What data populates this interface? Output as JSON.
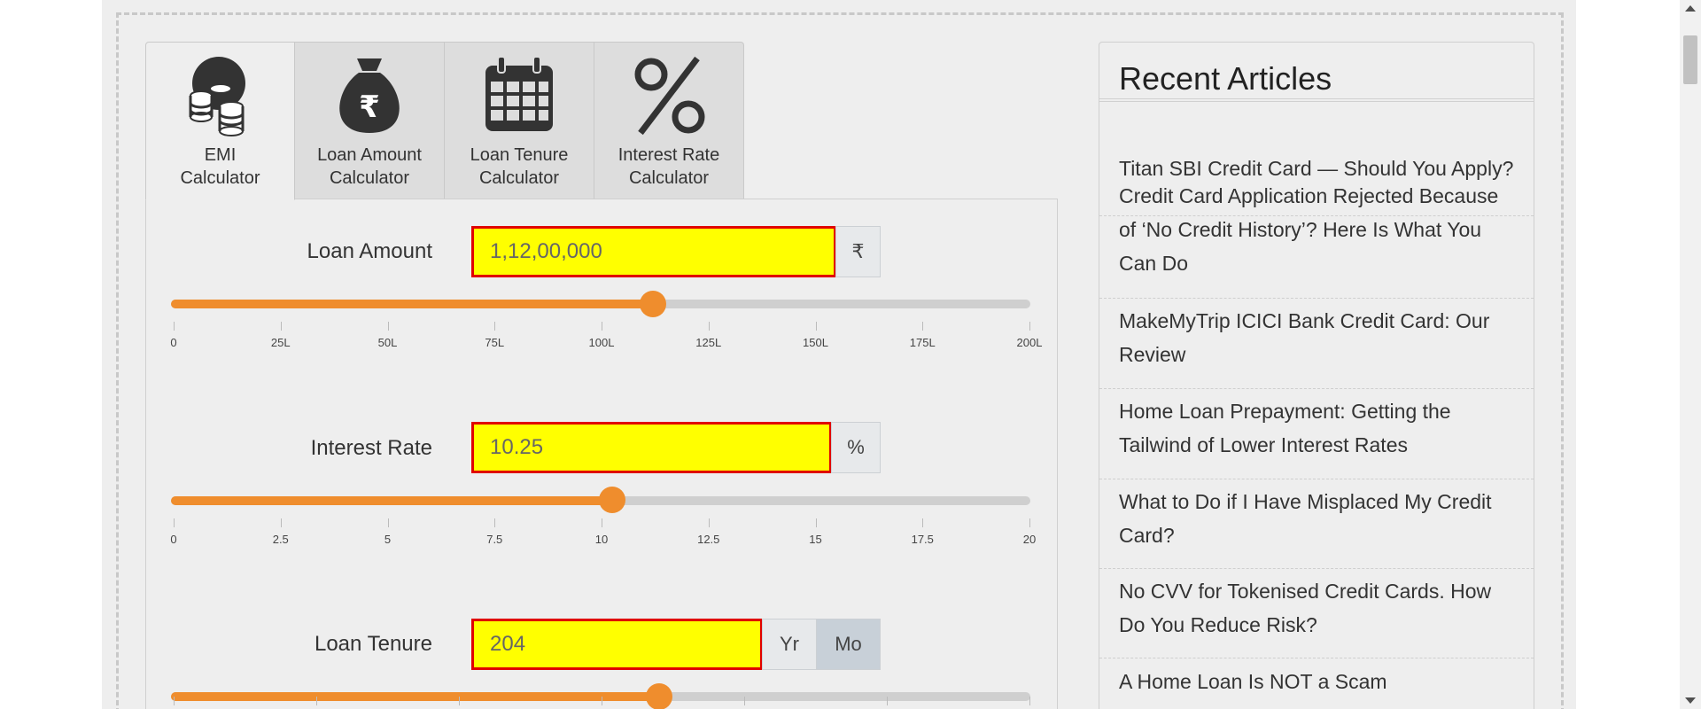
{
  "tabs": [
    {
      "line1": "EMI",
      "line2": "Calculator",
      "icon": "coins-icon",
      "active": true
    },
    {
      "line1": "Loan Amount",
      "line2": "Calculator",
      "icon": "money-bag-icon",
      "active": false
    },
    {
      "line1": "Loan Tenure",
      "line2": "Calculator",
      "icon": "calendar-icon",
      "active": false
    },
    {
      "line1": "Interest Rate",
      "line2": "Calculator",
      "icon": "percent-icon",
      "active": false
    }
  ],
  "loan_amount": {
    "label": "Loan Amount",
    "value": "1,12,00,000",
    "unit": "₹",
    "slider_fraction": 0.56,
    "ticks": [
      "0",
      "25L",
      "50L",
      "75L",
      "100L",
      "125L",
      "150L",
      "175L",
      "200L"
    ]
  },
  "interest_rate": {
    "label": "Interest Rate",
    "value": "10.25",
    "unit": "%",
    "slider_fraction": 0.5125,
    "ticks": [
      "0",
      "2.5",
      "5",
      "7.5",
      "10",
      "12.5",
      "15",
      "17.5",
      "20"
    ]
  },
  "loan_tenure": {
    "label": "Loan Tenure",
    "value": "204",
    "unit_year": "Yr",
    "unit_month": "Mo",
    "selected_unit": "Mo",
    "slider_fraction": 0.567
  },
  "sidebar": {
    "title": "Recent Articles",
    "articles": [
      "Titan SBI Credit Card — Should You Apply?",
      "Credit Card Application Rejected Because of ‘No Credit History’? Here Is What You Can Do",
      "MakeMyTrip ICICI Bank Credit Card: Our Review",
      "Home Loan Prepayment: Getting the Tailwind of Lower Interest Rates",
      "What to Do if I Have Misplaced My Credit Card?",
      "No CVV for Tokenised Credit Cards. How Do You Reduce Risk?",
      "A Home Loan Is NOT a Scam"
    ]
  },
  "colors": {
    "accent": "#ef8d2d",
    "field_bg": "#ffff00",
    "field_border": "#e00000",
    "icon": "#333333"
  }
}
